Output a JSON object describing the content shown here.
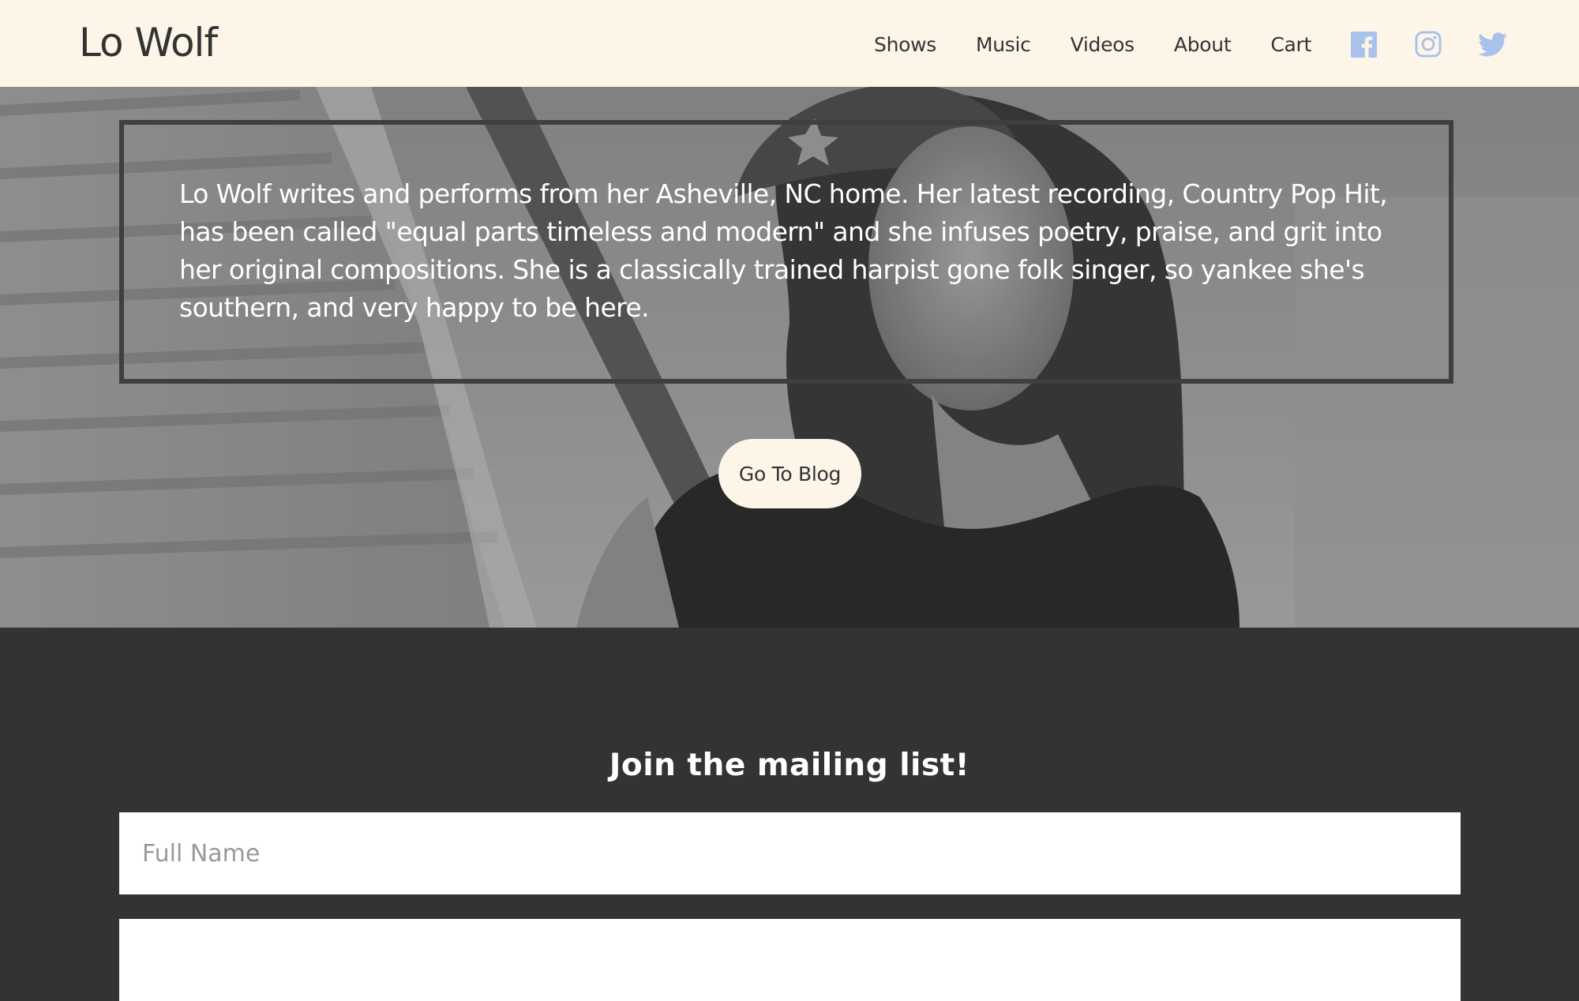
{
  "header": {
    "logo": "Lo Wolf",
    "nav": [
      "Shows",
      "Music",
      "Videos",
      "About",
      "Cart"
    ],
    "social": [
      {
        "icon": "facebook-icon",
        "color": "#a9c2ec"
      },
      {
        "icon": "instagram-icon",
        "color": "#a9c2ec"
      },
      {
        "icon": "twitter-icon",
        "color": "#a9c2ec"
      }
    ]
  },
  "hero": {
    "bio": "Lo Wolf writes and performs from her Asheville, NC home. Her latest recording, Country Pop Hit, has been called \"equal parts timeless and modern\" and she infuses poetry, praise, and grit into her original compositions. She is a classically trained harpist gone folk singer, so yankee she's southern, and very happy to be here.",
    "button": "Go To Blog"
  },
  "mailing": {
    "title": "Join the mailing list!",
    "name_placeholder": "Full Name",
    "email_placeholder": ""
  },
  "colors": {
    "header_bg": "#fdf6e8",
    "text_dark": "#333333",
    "footer_bg": "#333333",
    "icon_blue": "#a9c2ec"
  }
}
